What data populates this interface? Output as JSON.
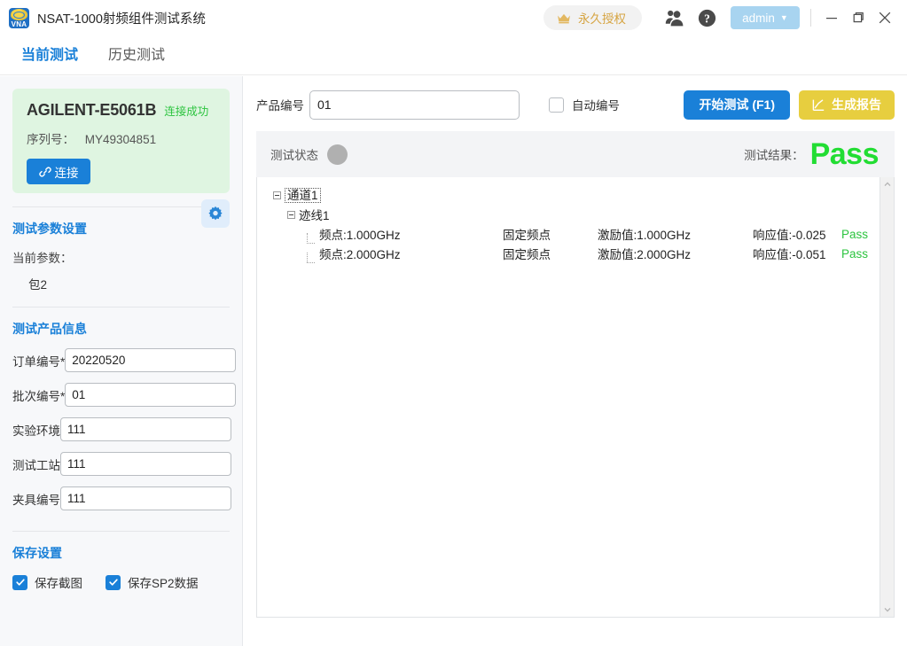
{
  "titlebar": {
    "app_title": "NSAT-1000射频组件测试系统",
    "logo_text": "VNA",
    "license_label": "永久授权",
    "users_icon": "users-icon",
    "help_icon": "help-icon",
    "user_name": "admin",
    "caret": "▼",
    "minimize": "—",
    "maximize": "▢",
    "close": "✕"
  },
  "tabs": [
    {
      "label": "当前测试",
      "active": true
    },
    {
      "label": "历史测试",
      "active": false
    }
  ],
  "sidebar": {
    "device": {
      "name": "AGILENT-E5061B",
      "status": "连接成功",
      "serial_label": "序列号：",
      "serial_value": "MY49304851",
      "connect_label": "连接",
      "connect_icon": "link-icon"
    },
    "param_section": {
      "title": "测试参数设置",
      "gear_icon": "gear-icon",
      "current_label": "当前参数：",
      "current_value": "包2"
    },
    "product_section": {
      "title": "测试产品信息",
      "fields": [
        {
          "label": "订单编号*",
          "value": "20220520"
        },
        {
          "label": "批次编号*",
          "value": "01"
        },
        {
          "label": "实验环境",
          "value": "111"
        },
        {
          "label": "测试工站",
          "value": "111"
        },
        {
          "label": "夹具编号",
          "value": "111"
        }
      ]
    },
    "save_section": {
      "title": "保存设置",
      "options": [
        {
          "label": "保存截图",
          "checked": true
        },
        {
          "label": "保存SP2数据",
          "checked": true
        }
      ]
    }
  },
  "main": {
    "toolbar": {
      "product_label": "产品编号",
      "product_value": "01",
      "product_placeholder": "",
      "auto_number_label": "自动编号",
      "auto_number_checked": false,
      "start_label": "开始测试 (F1)",
      "report_label": "生成报告",
      "report_icon": "chart-line-icon"
    },
    "status": {
      "status_label": "测试状态",
      "result_label": "测试结果：",
      "result_value": "Pass",
      "result_color": "#22dd33"
    },
    "tree": {
      "channel": "通道1",
      "trace": "迹线1",
      "rows": [
        {
          "freq": "频点:1.000GHz",
          "type": "固定频点",
          "stimulus": "激励值:1.000GHz",
          "response": "响应值:-0.025",
          "verdict": "Pass"
        },
        {
          "freq": "频点:2.000GHz",
          "type": "固定频点",
          "stimulus": "激励值:2.000GHz",
          "response": "响应值:-0.051",
          "verdict": "Pass"
        }
      ]
    }
  },
  "colors": {
    "accent": "#1a80d8",
    "pass_green": "#22dd33",
    "report_yellow": "#e7ce3f",
    "device_card_bg": "#dff5e1",
    "license_gold": "#d6a441"
  }
}
